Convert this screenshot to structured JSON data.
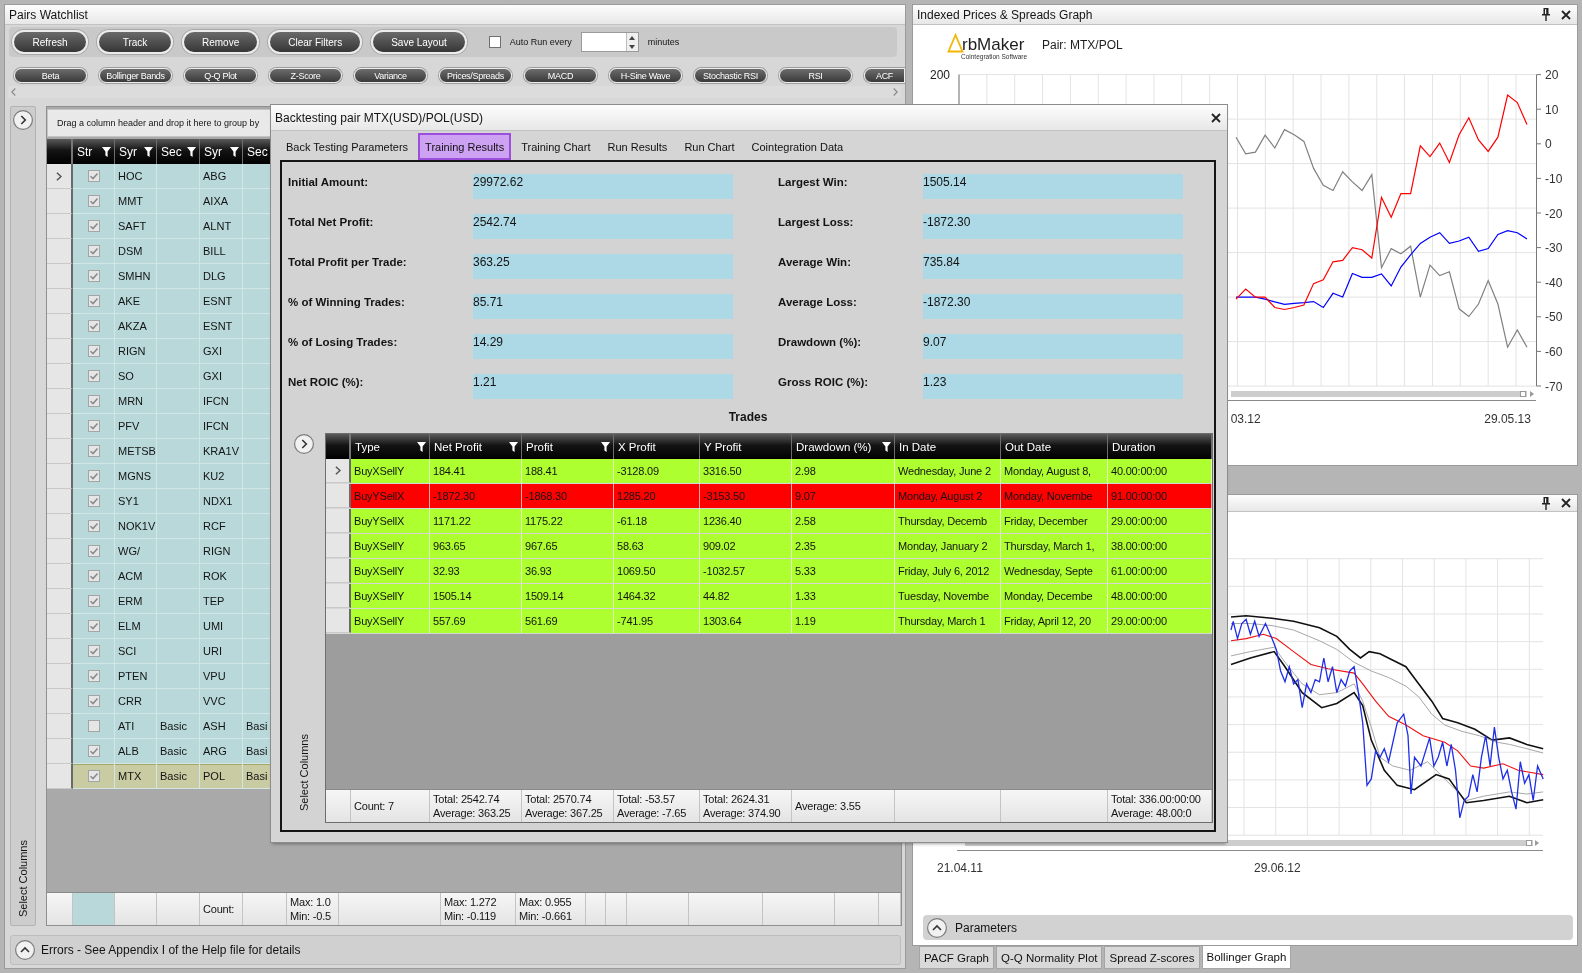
{
  "watchlist": {
    "title": "Pairs Watchlist",
    "toolbar_buttons": [
      "Refresh",
      "Track",
      "Remove",
      "Clear Filters",
      "Save Layout"
    ],
    "auto_run": {
      "label": "Auto Run every",
      "checked": false,
      "unit": "minutes"
    },
    "indicator_buttons": [
      "Beta",
      "Bollinger Bands",
      "Q-Q Plot",
      "Z-Score",
      "Variance",
      "Prices/Spreads",
      "MACD",
      "H-Sine Wave",
      "Stochastic RSI",
      "RSI",
      "ACF"
    ],
    "grid": {
      "side_label": "Select Columns",
      "group_hint": "Drag a column header and drop it here to group by",
      "columns": [
        {
          "label": "Str",
          "filter": true
        },
        {
          "label": "Syr",
          "filter": true
        },
        {
          "label": "Sec",
          "filter": true
        },
        {
          "label": "Syr",
          "filter": true
        },
        {
          "label": "Sec"
        }
      ],
      "rows": [
        {
          "current": true,
          "selected": false,
          "checked": true,
          "symbol_1": "HOC",
          "symbol_2": "ABG"
        },
        {
          "current": false,
          "selected": false,
          "checked": true,
          "symbol_1": "MMT",
          "symbol_2": "AIXA"
        },
        {
          "current": false,
          "selected": false,
          "checked": true,
          "symbol_1": "SAFT",
          "symbol_2": "ALNT"
        },
        {
          "current": false,
          "selected": false,
          "checked": true,
          "symbol_1": "DSM",
          "symbol_2": "BILL"
        },
        {
          "current": false,
          "selected": false,
          "checked": true,
          "symbol_1": "SMHN",
          "symbol_2": "DLG"
        },
        {
          "current": false,
          "selected": false,
          "checked": true,
          "symbol_1": "AKE",
          "symbol_2": "ESNT"
        },
        {
          "current": false,
          "selected": false,
          "checked": true,
          "symbol_1": "AKZA",
          "symbol_2": "ESNT"
        },
        {
          "current": false,
          "selected": false,
          "checked": true,
          "symbol_1": "RIGN",
          "symbol_2": "GXI"
        },
        {
          "current": false,
          "selected": false,
          "checked": true,
          "symbol_1": "SO",
          "symbol_2": "GXI"
        },
        {
          "current": false,
          "selected": false,
          "checked": true,
          "symbol_1": "MRN",
          "symbol_2": "IFCN"
        },
        {
          "current": false,
          "selected": false,
          "checked": true,
          "symbol_1": "PFV",
          "symbol_2": "IFCN"
        },
        {
          "current": false,
          "selected": false,
          "checked": true,
          "symbol_1": "METSB",
          "symbol_2": "KRA1V"
        },
        {
          "current": false,
          "selected": false,
          "checked": true,
          "symbol_1": "MGNS",
          "symbol_2": "KU2"
        },
        {
          "current": false,
          "selected": false,
          "checked": true,
          "symbol_1": "SY1",
          "symbol_2": "NDX1"
        },
        {
          "current": false,
          "selected": false,
          "checked": true,
          "symbol_1": "NOK1V",
          "symbol_2": "RCF"
        },
        {
          "current": false,
          "selected": false,
          "checked": true,
          "symbol_1": "WG/",
          "symbol_2": "RIGN"
        },
        {
          "current": false,
          "selected": false,
          "checked": true,
          "symbol_1": "ACM",
          "symbol_2": "ROK"
        },
        {
          "current": false,
          "selected": false,
          "checked": true,
          "symbol_1": "ERM",
          "symbol_2": "TEP"
        },
        {
          "current": false,
          "selected": false,
          "checked": true,
          "symbol_1": "ELM",
          "symbol_2": "UMI"
        },
        {
          "current": false,
          "selected": false,
          "checked": true,
          "symbol_1": "SCI",
          "symbol_2": "URI"
        },
        {
          "current": false,
          "selected": false,
          "checked": true,
          "symbol_1": "PTEN",
          "symbol_2": "VPU"
        },
        {
          "current": false,
          "selected": false,
          "checked": true,
          "symbol_1": "CRR",
          "symbol_2": "VVC"
        },
        {
          "current": false,
          "selected": false,
          "checked": false,
          "symbol_1": "ATI",
          "sector_1": "Basic",
          "symbol_2": "ASH",
          "sector_2": "Basi"
        },
        {
          "current": false,
          "selected": false,
          "checked": true,
          "symbol_1": "ALB",
          "sector_1": "Basic",
          "symbol_2": "ARG",
          "sector_2": "Basi"
        },
        {
          "current": false,
          "selected": true,
          "checked": true,
          "symbol_1": "MTX",
          "sector_1": "Basic",
          "symbol_2": "POL",
          "sector_2": "Basi"
        }
      ],
      "footer": [
        {
          "kind": "shaded"
        },
        {
          "kind": "blank"
        },
        {
          "kind": "blank"
        },
        {
          "kind": "summary",
          "lines": [
            "Count:"
          ]
        },
        {
          "kind": "blank"
        },
        {
          "kind": "summary",
          "lines": [
            "Max: 1.0",
            "Min: -0.5"
          ]
        },
        {
          "kind": "blank"
        },
        {
          "kind": "summary",
          "lines": [
            "Max: 1.272",
            "Min: -0.119"
          ]
        },
        {
          "kind": "summary",
          "lines": [
            "Max: 0.955",
            "Min: -0.661"
          ]
        },
        {
          "kind": "blank"
        },
        {
          "kind": "blank"
        },
        {
          "kind": "blank"
        },
        {
          "kind": "blank"
        },
        {
          "kind": "blank"
        },
        {
          "kind": "blank"
        },
        {
          "kind": "blank"
        }
      ]
    },
    "errors_bar": "Errors - See Appendix I of the Help file for details"
  },
  "prices_graph": {
    "title": "Indexed Prices & Spreads Graph",
    "logo": {
      "name": "rbMaker",
      "tagline": "Cointegration Software"
    },
    "pair": "Pair: MTX/POL",
    "left_axis_label": "200",
    "chart_data": {
      "type": "line",
      "categories": [
        null,
        "03.12",
        null,
        null,
        null,
        null,
        null,
        null,
        null,
        null,
        null,
        null,
        null,
        null,
        null,
        null,
        null,
        null,
        null,
        null,
        null,
        null,
        null,
        null,
        null,
        null,
        null,
        null,
        "29.05.13",
        null,
        null
      ],
      "ylim": [
        -70,
        20
      ],
      "yticks": [
        20,
        10,
        0,
        -10,
        -20,
        -30,
        -40,
        -50,
        -60,
        -70
      ],
      "series": [
        {
          "color": "#808080",
          "values": [
            1.9,
            -2.9,
            -2.4,
            2.5,
            -1.2,
            4.1,
            2.6,
            0.7,
            -7.1,
            -12.0,
            -13.5,
            -8.1,
            -11.0,
            -13.5,
            -8.9,
            -35.8,
            -30.3,
            -31.8,
            -29.6,
            -44.3,
            -35.1,
            -38.1,
            -37.0,
            -47.7,
            -49.9,
            -46.3,
            -39.5,
            -46.3,
            -58.8,
            -53.8,
            -58.8
          ]
        },
        {
          "color": "#0000ff",
          "values": [
            -44.3,
            -44.3,
            -44.3,
            -44.9,
            -45.7,
            -46.4,
            -46.1,
            -45.9,
            -45.6,
            -47.3,
            -43.2,
            -44.3,
            -37.5,
            -38.6,
            -38.6,
            -37.6,
            -41.1,
            -35.6,
            -32.1,
            -28.8,
            -27.0,
            -25.7,
            -28.8,
            -28.1,
            -27.0,
            -31.1,
            -30.3,
            -26.2,
            -25.1,
            -25.7,
            -27.5
          ]
        },
        {
          "color": "#ff0000",
          "values": [
            -44.9,
            -42.0,
            -44.3,
            -44.3,
            -47.3,
            -47.9,
            -47.3,
            -46.6,
            -40.4,
            -39.3,
            -34.1,
            -33.7,
            -30.0,
            -30.6,
            -33.0,
            -15.5,
            -21.2,
            -14.4,
            -14.4,
            -0.6,
            -3.7,
            0.2,
            -5.4,
            2.6,
            7.5,
            1.1,
            -2.2,
            1.9,
            14.1,
            11.9,
            5.6
          ]
        }
      ]
    }
  },
  "bollinger_graph": {
    "x_axis_labels": [
      "21.04.11",
      "29.06.12"
    ],
    "parameters": "Parameters",
    "tabs": [
      {
        "label": "PACF Graph",
        "selected": false
      },
      {
        "label": "Q-Q Normality Plot",
        "selected": false
      },
      {
        "label": "Spread Z-scores",
        "selected": false
      },
      {
        "label": "Bollinger Graph",
        "selected": true
      }
    ]
  },
  "dialog": {
    "title": "Backtesting pair MTX(USD)/POL(USD)",
    "tabs": [
      {
        "label": "Back Testing Parameters",
        "selected": false
      },
      {
        "label": "Training Results",
        "selected": true
      },
      {
        "label": "Training Chart",
        "selected": false
      },
      {
        "label": "Run Results",
        "selected": false
      },
      {
        "label": "Run Chart",
        "selected": false
      },
      {
        "label": "Cointegration Data",
        "selected": false
      }
    ],
    "summary_left": [
      {
        "label": "Initial Amount:",
        "value": "29972.62"
      },
      {
        "label": "Total Net Profit:",
        "value": "2542.74"
      },
      {
        "label": "Total Profit per Trade:",
        "value": "363.25"
      },
      {
        "label": "% of Winning Trades:",
        "value": "85.71"
      },
      {
        "label": "% of Losing Trades:",
        "value": "14.29"
      },
      {
        "label": "Net ROIC (%):",
        "value": "1.21"
      }
    ],
    "summary_right": [
      {
        "label": "Largest Win:",
        "value": "1505.14"
      },
      {
        "label": "Largest Loss:",
        "value": "-1872.30"
      },
      {
        "label": "Average Win:",
        "value": "735.84"
      },
      {
        "label": "Average Loss:",
        "value": "-1872.30"
      },
      {
        "label": "Drawdown (%):",
        "value": "9.07"
      },
      {
        "label": "Gross ROIC (%):",
        "value": "1.23"
      }
    ],
    "trades": {
      "title": "Trades",
      "side_label": "Select Columns",
      "columns": [
        {
          "label": "Type",
          "filter": true
        },
        {
          "label": "Net Profit",
          "filter": true
        },
        {
          "label": "Profit",
          "filter": true
        },
        {
          "label": "X Profit",
          "filter": false
        },
        {
          "label": "Y Profit",
          "filter": false
        },
        {
          "label": "Drawdown (%)",
          "filter": true
        },
        {
          "label": "In Date",
          "filter": false
        },
        {
          "label": "Out Date",
          "filter": false
        },
        {
          "label": "Duration",
          "filter": false
        }
      ],
      "rows": [
        {
          "current": true,
          "color": "#adff2f",
          "cells": [
            "BuyXSellY",
            "184.41",
            "188.41",
            "-3128.09",
            "3316.50",
            "2.98",
            "Wednesday, June 2",
            "Monday, August 8,",
            "40.00:00:00"
          ]
        },
        {
          "current": false,
          "color": "#ff0000",
          "cells": [
            "BuyYSellX",
            "-1872.30",
            "-1868.30",
            "1285.20",
            "-3153.50",
            "9.07",
            "Monday, August 2",
            "Monday, Novembe",
            "91.00:00:00"
          ]
        },
        {
          "current": false,
          "color": "#adff2f",
          "cells": [
            "BuyYSellX",
            "1171.22",
            "1175.22",
            "-61.18",
            "1236.40",
            "2.58",
            "Thursday, Decemb",
            "Friday, December",
            "29.00:00:00"
          ]
        },
        {
          "current": false,
          "color": "#adff2f",
          "cells": [
            "BuyXSellY",
            "963.65",
            "967.65",
            "58.63",
            "909.02",
            "2.35",
            "Monday, January 2",
            "Thursday, March 1,",
            "38.00:00:00"
          ]
        },
        {
          "current": false,
          "color": "#adff2f",
          "cells": [
            "BuyXSellY",
            "32.93",
            "36.93",
            "1069.50",
            "-1032.57",
            "5.33",
            "Friday, July 6, 2012",
            "Wednesday, Septe",
            "61.00:00:00"
          ]
        },
        {
          "current": false,
          "color": "#adff2f",
          "cells": [
            "BuyXSellY",
            "1505.14",
            "1509.14",
            "1464.32",
            "44.82",
            "1.33",
            "Tuesday, Novembe",
            "Monday, Decembe",
            "48.00:00:00"
          ]
        },
        {
          "current": false,
          "color": "#adff2f",
          "cells": [
            "BuyXSellY",
            "557.69",
            "561.69",
            "-741.95",
            "1303.64",
            "1.19",
            "Thursday, March 1",
            "Friday, April 12, 20",
            "29.00:00:00"
          ]
        }
      ],
      "footer": [
        {
          "kind": "summary",
          "lines": [
            "Count: 7"
          ]
        },
        {
          "kind": "summary",
          "lines": [
            "Total: 2542.74",
            "Average: 363.25"
          ]
        },
        {
          "kind": "summary",
          "lines": [
            "Total: 2570.74",
            "Average: 367.25"
          ]
        },
        {
          "kind": "summary",
          "lines": [
            "Total: -53.57",
            "Average: -7.65"
          ]
        },
        {
          "kind": "summary",
          "lines": [
            "Total: 2624.31",
            "Average: 374.90"
          ]
        },
        {
          "kind": "summary",
          "lines": [
            "Average: 3.55"
          ]
        },
        {
          "kind": "blank"
        },
        {
          "kind": "blank"
        },
        {
          "kind": "summary",
          "lines": [
            "Total: 336.00:00:00",
            "Average: 48.00:0"
          ]
        }
      ]
    }
  }
}
